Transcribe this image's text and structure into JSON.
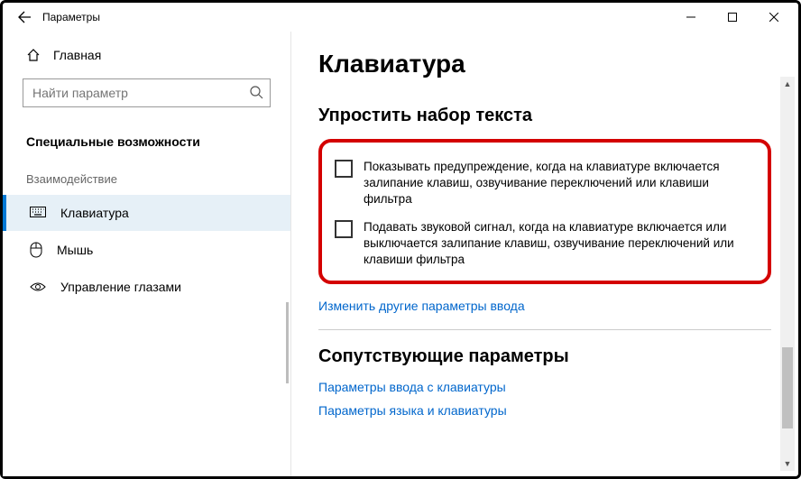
{
  "window": {
    "title": "Параметры"
  },
  "sidebar": {
    "home": "Главная",
    "search_placeholder": "Найти параметр",
    "group_head": "Специальные возможности",
    "section_label": "Взаимодействие",
    "items": [
      {
        "label": "Клавиатура"
      },
      {
        "label": "Мышь"
      },
      {
        "label": "Управление глазами"
      }
    ]
  },
  "main": {
    "heading": "Клавиатура",
    "section1_title": "Упростить набор текста",
    "check1": "Показывать предупреждение, когда на клавиатуре включается залипание клавиш, озвучивание переключений или клавиши фильтра",
    "check2": "Подавать звуковой сигнал, когда на клавиатуре включается или выключается залипание клавиш, озвучивание переключений или клавиши фильтра",
    "link1": "Изменить другие параметры ввода",
    "section2_title": "Сопутствующие параметры",
    "link2": "Параметры ввода с клавиатуры",
    "link3": "Параметры языка и клавиатуры"
  }
}
